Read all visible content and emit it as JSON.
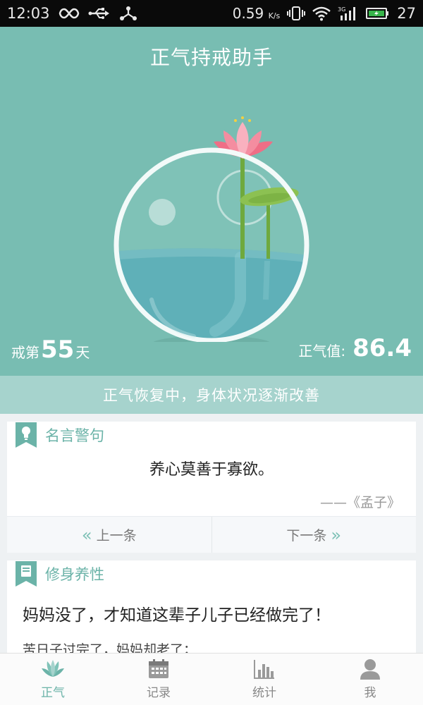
{
  "status_bar": {
    "time": "12:03",
    "net_speed": "0.59",
    "net_unit": "K/s",
    "battery": "27",
    "icons": [
      "infinity-icon",
      "usb-icon",
      "share-icon",
      "vibrate-icon",
      "wifi-icon",
      "signal-3g-icon",
      "battery-icon"
    ]
  },
  "hero": {
    "title": "正气持戒助手",
    "days_prefix": "戒第",
    "days": "55",
    "days_suffix": "天",
    "score_label": "正气值:",
    "score": "86.4"
  },
  "status_message": "正气恢复中，身体状况逐渐改善",
  "quote_card": {
    "label": "名言警句",
    "text": "养心莫善于寡欲。",
    "source": "——《孟子》",
    "prev_label": "上一条",
    "next_label": "下一条",
    "icon": "lightbulb-icon"
  },
  "article_card": {
    "label": "修身养性",
    "title": "妈妈没了，才知道这辈子儿子已经做完了！",
    "first_line": "苦日子过完了，妈妈却老了；",
    "icon": "book-icon"
  },
  "tabs": [
    {
      "label": "正气",
      "icon": "lotus-icon",
      "active": true
    },
    {
      "label": "记录",
      "icon": "calendar-icon",
      "active": false
    },
    {
      "label": "统计",
      "icon": "bar-chart-icon",
      "active": false
    },
    {
      "label": "我",
      "icon": "person-icon",
      "active": false
    }
  ],
  "colors": {
    "accent": "#78bdb2",
    "accent_text": "#6bb3a8",
    "strip": "#a6d3cd",
    "water": "#5fb0b8",
    "lotus": "#f07e93"
  }
}
